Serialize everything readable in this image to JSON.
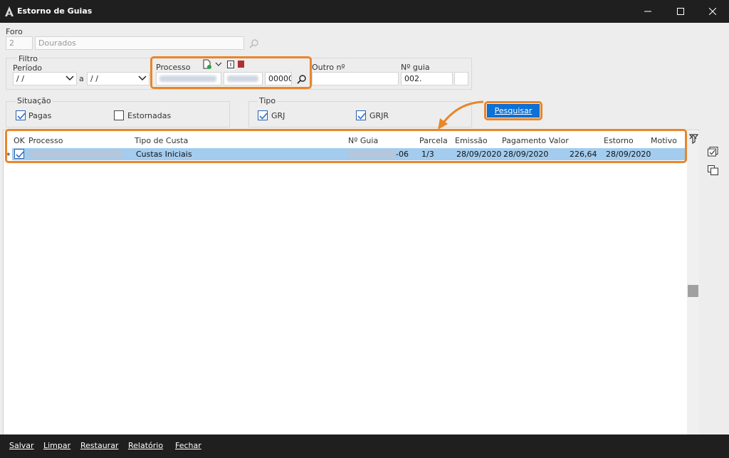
{
  "window": {
    "title": "Estorno de Guias"
  },
  "foro": {
    "label": "Foro",
    "code": "2",
    "name": "Dourados"
  },
  "filtro": {
    "label": "Filtro",
    "periodo_label": "Período",
    "date_from": " / /",
    "separator": "a",
    "date_to": " / /",
    "processo_label": "Processo",
    "processo_suffix": "00000",
    "outro_label": "Outro nº",
    "guia_label": "Nº guia",
    "guia_value": "002."
  },
  "situacao": {
    "label": "Situação",
    "pagas": "Pagas",
    "estornadas": "Estornadas"
  },
  "tipo": {
    "label": "Tipo",
    "grj": "GRJ",
    "grjr": "GRJR"
  },
  "pesquisar": "Pesquisar",
  "grid": {
    "columns": [
      "OK",
      "Processo",
      "Tipo de Custa",
      "Nº Guia",
      "Parcela",
      "Emissão",
      "Pagamento",
      "Valor",
      "Estorno",
      "Motivo"
    ],
    "rows": [
      {
        "marker": "*",
        "tipo": "Custas Iniciais",
        "guia_suffix": "-06",
        "parcela": "1/3",
        "emissao": "28/09/2020",
        "pagamento": "28/09/2020",
        "valor": "226,64",
        "estorno": "28/09/2020"
      }
    ]
  },
  "footer": {
    "salvar": "Salvar",
    "limpar": "Limpar",
    "restaurar": "Restaurar",
    "relatorio": "Relatório",
    "fechar": "Fechar"
  }
}
